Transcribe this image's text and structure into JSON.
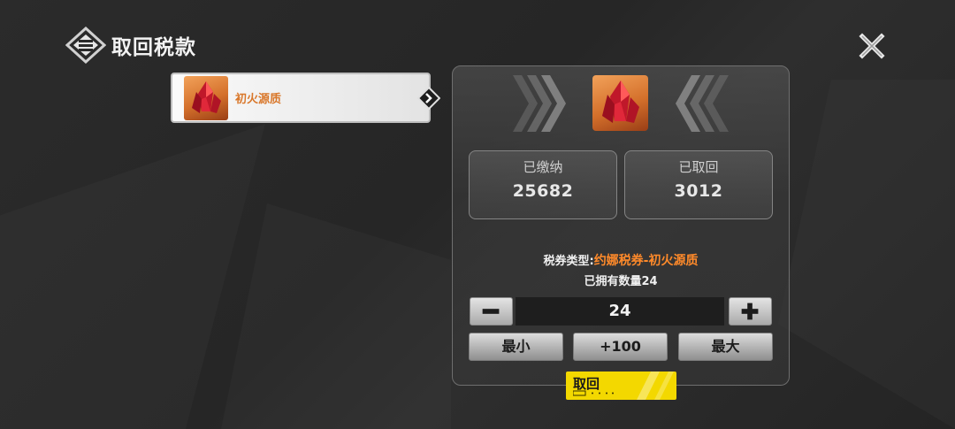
{
  "header": {
    "title": "取回税款",
    "logo_icon": "emblem-icon",
    "close_icon": "close-icon"
  },
  "item_list": [
    {
      "label": "初火源质",
      "icon": "red-crystal-icon",
      "selected": true
    }
  ],
  "detail": {
    "icon": "red-crystal-icon",
    "paid_label": "已缴纳",
    "paid_value": "25682",
    "retrieved_label": "已取回",
    "retrieved_value": "3012",
    "ticket_type_label": "税券类型:",
    "ticket_type_value": "约娜税券-初火源质",
    "owned_text": "已拥有数量24",
    "quantity": "24",
    "min_label": "最小",
    "plus100_label": "+100",
    "max_label": "最大",
    "retrieve_label": "取回"
  },
  "colors": {
    "accent_orange": "#ff8a2a",
    "confirm_yellow": "#f3d800"
  }
}
